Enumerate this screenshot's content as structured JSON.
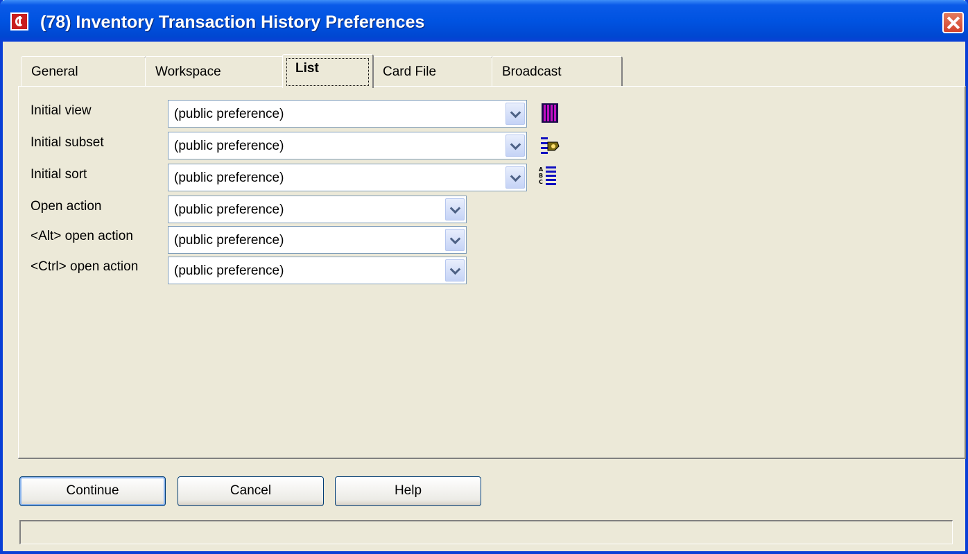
{
  "window": {
    "title": "(78) Inventory Transaction History Preferences"
  },
  "tabs": [
    {
      "label": "General",
      "active": false
    },
    {
      "label": "Workspace",
      "active": false
    },
    {
      "label": "List",
      "active": true
    },
    {
      "label": "Card File",
      "active": false
    },
    {
      "label": "Broadcast",
      "active": false
    }
  ],
  "fields": [
    {
      "label": "Initial view",
      "value": "(public preference)",
      "icon": "view-layout-icon"
    },
    {
      "label": "Initial subset",
      "value": "(public preference)",
      "icon": "subset-filter-icon"
    },
    {
      "label": "Initial sort",
      "value": "(public preference)",
      "icon": "sort-abc-icon"
    },
    {
      "label": "Open action",
      "value": "(public preference)"
    },
    {
      "label": "<Alt> open action",
      "value": "(public preference)"
    },
    {
      "label": "<Ctrl> open action",
      "value": "(public preference)"
    }
  ],
  "buttons": {
    "continue": "Continue",
    "cancel": "Cancel",
    "help": "Help"
  },
  "status": "",
  "colors": {
    "titlebar": "#0053e1",
    "face": "#ece9d8",
    "combo_border": "#7f9db9"
  }
}
